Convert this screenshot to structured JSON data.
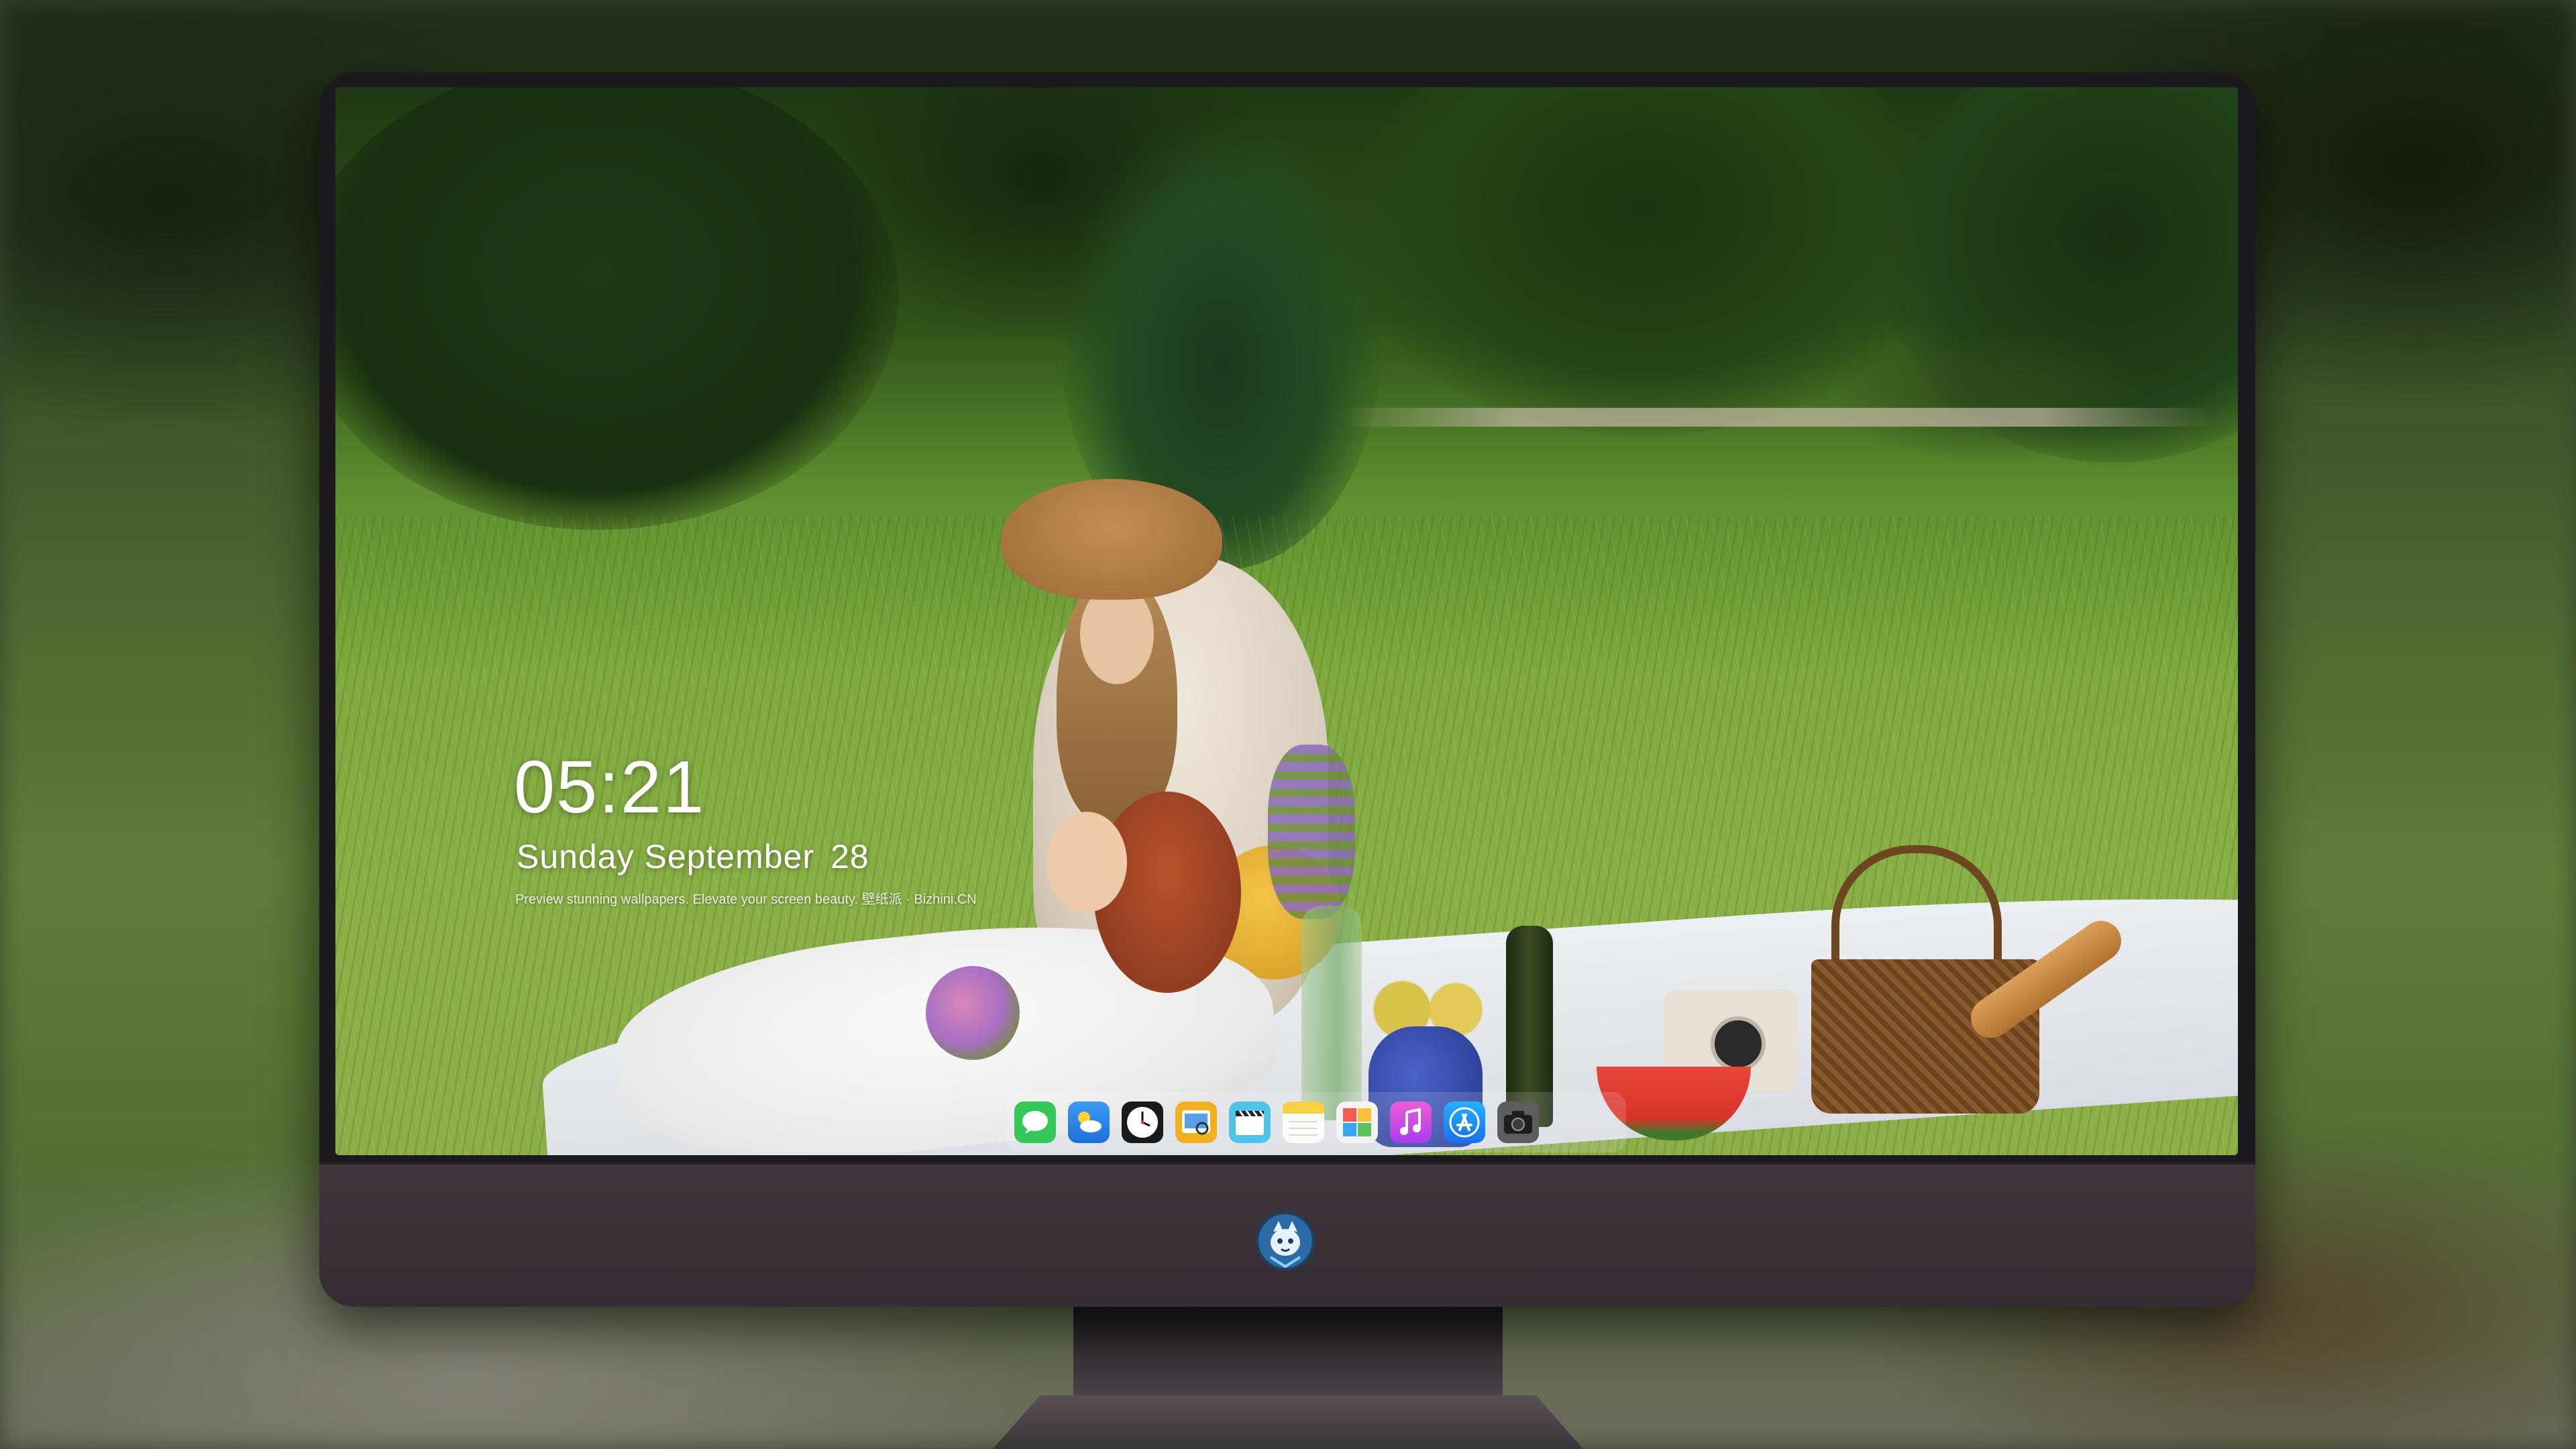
{
  "clock": {
    "time": "05:21",
    "weekday": "Sunday",
    "month": "September",
    "day": "28",
    "caption": "Preview stunning wallpapers. Elevate your screen beauty. 壁纸派 · Bizhini.CN"
  },
  "dock": {
    "apps": [
      {
        "name": "messages-icon",
        "color": "#34c759"
      },
      {
        "name": "weather-icon",
        "color": "#2f8ff0"
      },
      {
        "name": "clock-icon",
        "color": "#1a1a1a"
      },
      {
        "name": "preview-icon",
        "color": "#f2b01e"
      },
      {
        "name": "clips-icon",
        "color": "#4fc3e8"
      },
      {
        "name": "notes-icon",
        "color": "#f7d046"
      },
      {
        "name": "photos-icon",
        "color": "#f3f3f3"
      },
      {
        "name": "music-icon",
        "color": "#d64be3"
      },
      {
        "name": "app-store-icon",
        "color": "#1c8ef7"
      },
      {
        "name": "camera-icon",
        "color": "#6d6d6d"
      }
    ]
  },
  "monitor": {
    "bezel_color": "#1c1a1e",
    "chin_color": "#3a3138"
  }
}
